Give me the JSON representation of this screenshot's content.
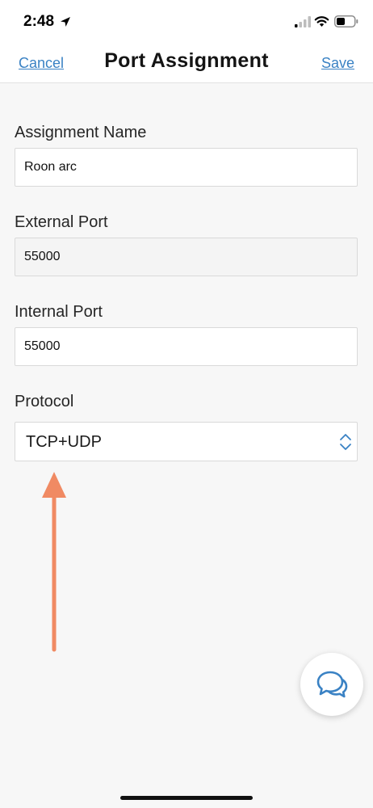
{
  "status_bar": {
    "time": "2:48"
  },
  "nav": {
    "cancel_label": "Cancel",
    "title": "Port Assignment",
    "save_label": "Save"
  },
  "form": {
    "assignment_name": {
      "label": "Assignment Name",
      "value": "Roon arc"
    },
    "external_port": {
      "label": "External Port",
      "value": "55000"
    },
    "internal_port": {
      "label": "Internal Port",
      "value": "55000"
    },
    "protocol": {
      "label": "Protocol",
      "selected": "TCP+UDP"
    }
  },
  "colors": {
    "accent": "#3a82c4",
    "annotation_arrow": "#f08a63",
    "background": "#f7f7f7"
  },
  "icons": {
    "location": "location-arrow-icon",
    "signal": "cellular-signal-icon",
    "wifi": "wifi-icon",
    "battery": "battery-icon",
    "select": "chevron-up-down-icon",
    "chat": "chat-bubbles-icon"
  }
}
